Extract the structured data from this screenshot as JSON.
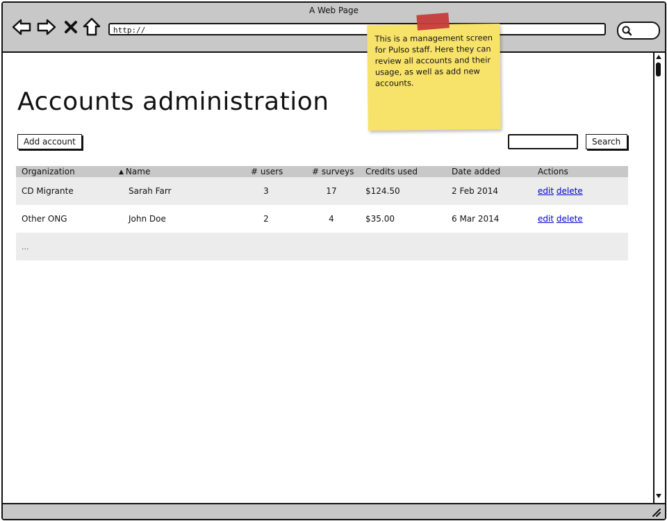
{
  "window": {
    "title": "A Web Page",
    "url": "http://"
  },
  "page": {
    "title": "Accounts administration",
    "add_button": "Add account",
    "search_button": "Search",
    "search_value": ""
  },
  "table": {
    "headers": {
      "organization": "Organization",
      "name": "Name",
      "users": "# users",
      "surveys": "# surveys",
      "credits": "Credits used",
      "date": "Date added",
      "actions": "Actions"
    },
    "sort": {
      "column": "name",
      "direction": "ascending"
    },
    "rows": [
      {
        "organization": "CD Migrante",
        "name": "Sarah Farr",
        "users": "3",
        "surveys": "17",
        "credits": "$124.50",
        "date": "2 Feb 2014",
        "edit": "edit",
        "delete": "delete"
      },
      {
        "organization": "Other ONG",
        "name": "John Doe",
        "users": "2",
        "surveys": "4",
        "credits": "$35.00",
        "date": "6 Mar 2014",
        "edit": "edit",
        "delete": "delete"
      }
    ],
    "more_rows": "..."
  },
  "note": {
    "text": "This is a management screen for Pulso staff. Here they can review all accounts and their usage, as well as add new accounts."
  },
  "colors": {
    "chrome": "#c8c8c8",
    "row_alt": "#ececec",
    "link": "#0000cc",
    "sticky_note": "#f7e36a",
    "sticky_tape": "#c63c3c"
  },
  "icons": [
    "back-arrow-icon",
    "forward-arrow-icon",
    "close-x-icon",
    "home-icon",
    "search-icon",
    "scroll-up-icon",
    "scroll-down-icon",
    "resize-grip-icon"
  ]
}
